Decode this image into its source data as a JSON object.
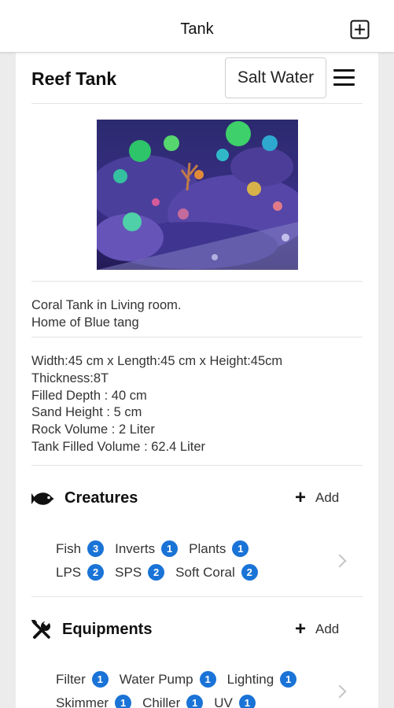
{
  "nav": {
    "title": "Tank"
  },
  "tank": {
    "name": "Reef Tank",
    "water_type": "Salt Water",
    "description": [
      "Coral Tank in Living room.",
      "Home of Blue tang"
    ],
    "specs": [
      "Width:45 cm x Length:45 cm x Height:45cm",
      "Thickness:8T",
      "Filled Depth : 40 cm",
      "Sand Height : 5 cm",
      "Rock Volume : 2 Liter",
      "Tank Filled Volume : 62.4 Liter"
    ]
  },
  "creatures": {
    "title": "Creatures",
    "add_label": "Add",
    "icon": "fish-icon",
    "rows": [
      [
        {
          "label": "Fish",
          "count": "3"
        },
        {
          "label": "Inverts",
          "count": "1"
        },
        {
          "label": "Plants",
          "count": "1"
        }
      ],
      [
        {
          "label": "LPS",
          "count": "2"
        },
        {
          "label": "SPS",
          "count": "2"
        },
        {
          "label": "Soft Coral",
          "count": "2"
        }
      ]
    ]
  },
  "equipments": {
    "title": "Equipments",
    "add_label": "Add",
    "icon": "tools-icon",
    "rows": [
      [
        {
          "label": "Filter",
          "count": "1"
        },
        {
          "label": "Water Pump",
          "count": "1"
        },
        {
          "label": "Lighting",
          "count": "1"
        }
      ],
      [
        {
          "label": "Skimmer",
          "count": "1"
        },
        {
          "label": "Chiller",
          "count": "1"
        },
        {
          "label": "UV",
          "count": "1"
        }
      ]
    ]
  },
  "colors": {
    "badge": "#1a73d6",
    "background": "#ececec",
    "card": "#ffffff"
  }
}
